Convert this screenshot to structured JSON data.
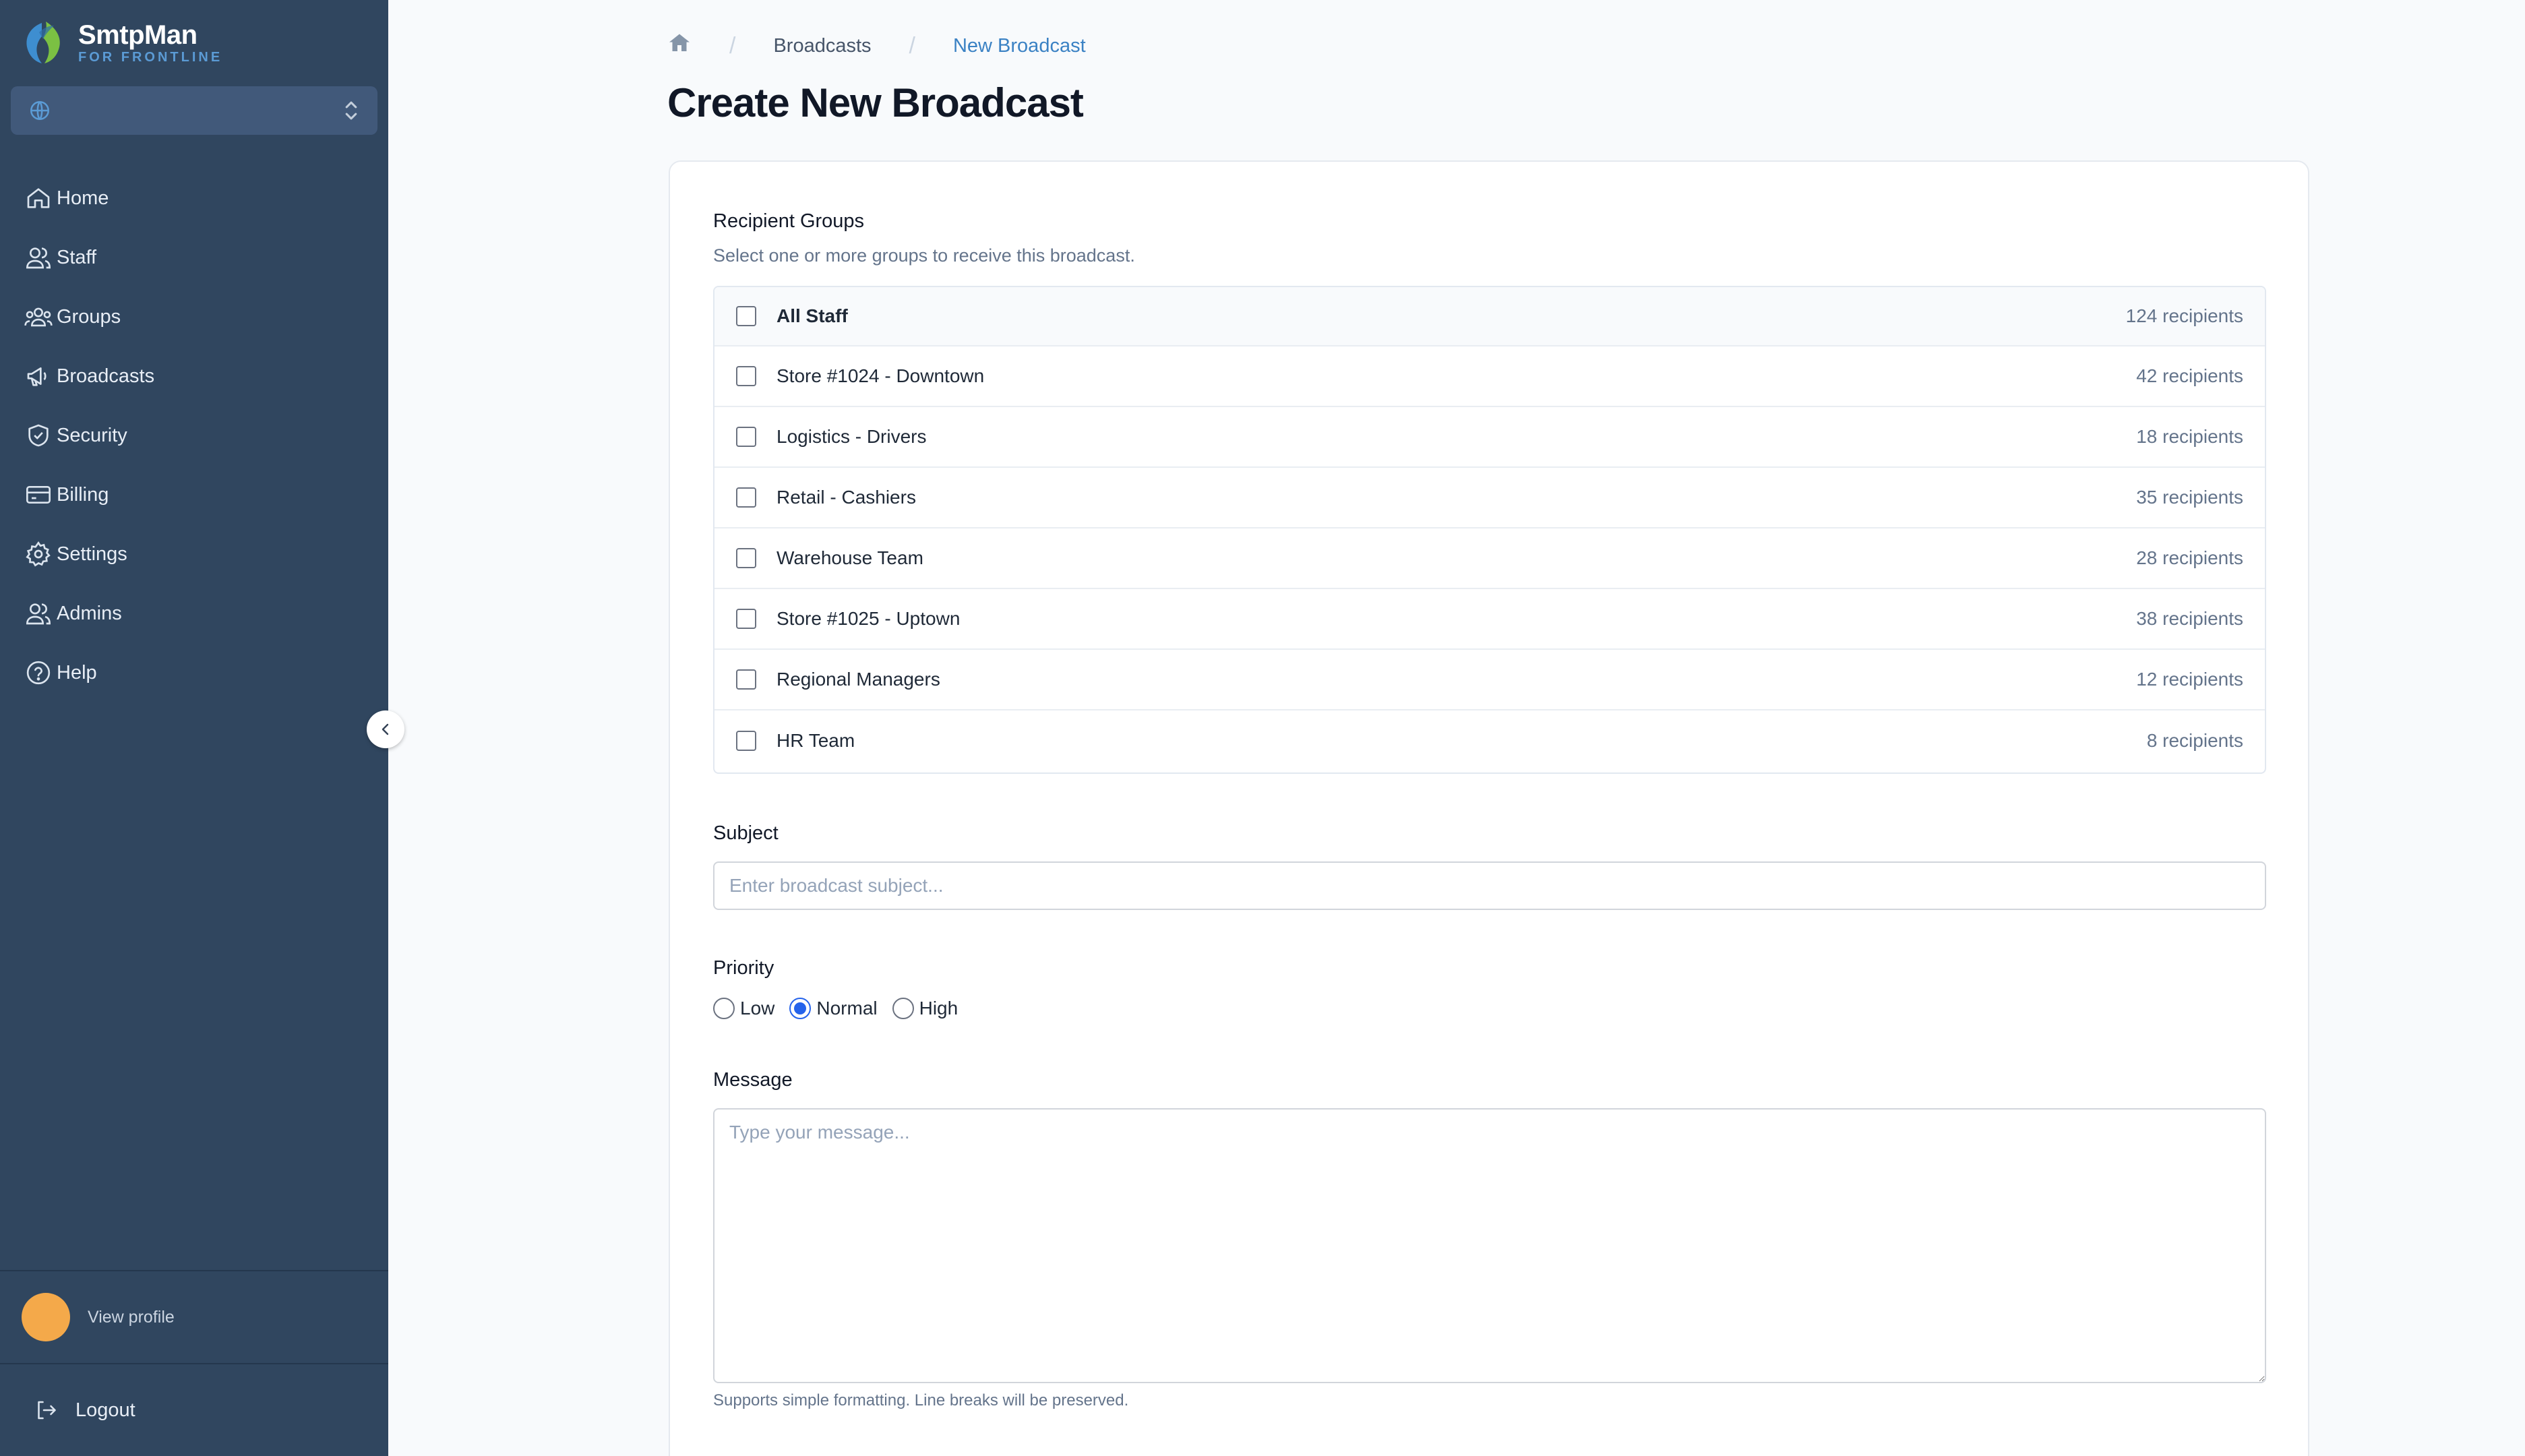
{
  "app": {
    "name": "SmtpMan",
    "tagline": "FOR FRONTLINE"
  },
  "workspace": {
    "icon": "globe-icon",
    "value": ""
  },
  "sidebar": {
    "items": [
      {
        "label": "Home",
        "icon": "home-icon"
      },
      {
        "label": "Staff",
        "icon": "users-icon"
      },
      {
        "label": "Groups",
        "icon": "group-icon"
      },
      {
        "label": "Broadcasts",
        "icon": "megaphone-icon"
      },
      {
        "label": "Security",
        "icon": "shield-check-icon"
      },
      {
        "label": "Billing",
        "icon": "credit-card-icon"
      },
      {
        "label": "Settings",
        "icon": "gear-icon"
      },
      {
        "label": "Admins",
        "icon": "users-icon"
      },
      {
        "label": "Help",
        "icon": "help-circle-icon"
      }
    ],
    "profile_label": "View profile",
    "logout_label": "Logout"
  },
  "breadcrumb": {
    "home_icon": "home-icon",
    "items": [
      "Broadcasts",
      "New Broadcast"
    ]
  },
  "page": {
    "title": "Create New Broadcast"
  },
  "form": {
    "recipients": {
      "label": "Recipient Groups",
      "help": "Select one or more groups to receive this broadcast.",
      "groups": [
        {
          "name": "All Staff",
          "count": "124 recipients",
          "checked": false
        },
        {
          "name": "Store #1024 - Downtown",
          "count": "42 recipients",
          "checked": false
        },
        {
          "name": "Logistics - Drivers",
          "count": "18 recipients",
          "checked": false
        },
        {
          "name": "Retail - Cashiers",
          "count": "35 recipients",
          "checked": false
        },
        {
          "name": "Warehouse Team",
          "count": "28 recipients",
          "checked": false
        },
        {
          "name": "Store #1025 - Uptown",
          "count": "38 recipients",
          "checked": false
        },
        {
          "name": "Regional Managers",
          "count": "12 recipients",
          "checked": false
        },
        {
          "name": "HR Team",
          "count": "8 recipients",
          "checked": false
        }
      ]
    },
    "subject": {
      "label": "Subject",
      "placeholder": "Enter broadcast subject...",
      "value": ""
    },
    "priority": {
      "label": "Priority",
      "options": [
        "Low",
        "Normal",
        "High"
      ],
      "selected": "Normal"
    },
    "message": {
      "label": "Message",
      "placeholder": "Type your message...",
      "value": "",
      "hint": "Supports simple formatting. Line breaks will be preserved."
    }
  },
  "colors": {
    "sidebar_bg": "#30465f",
    "accent": "#2563eb",
    "breadcrumb_active": "#3b82c4",
    "avatar": "#f4a94a"
  }
}
